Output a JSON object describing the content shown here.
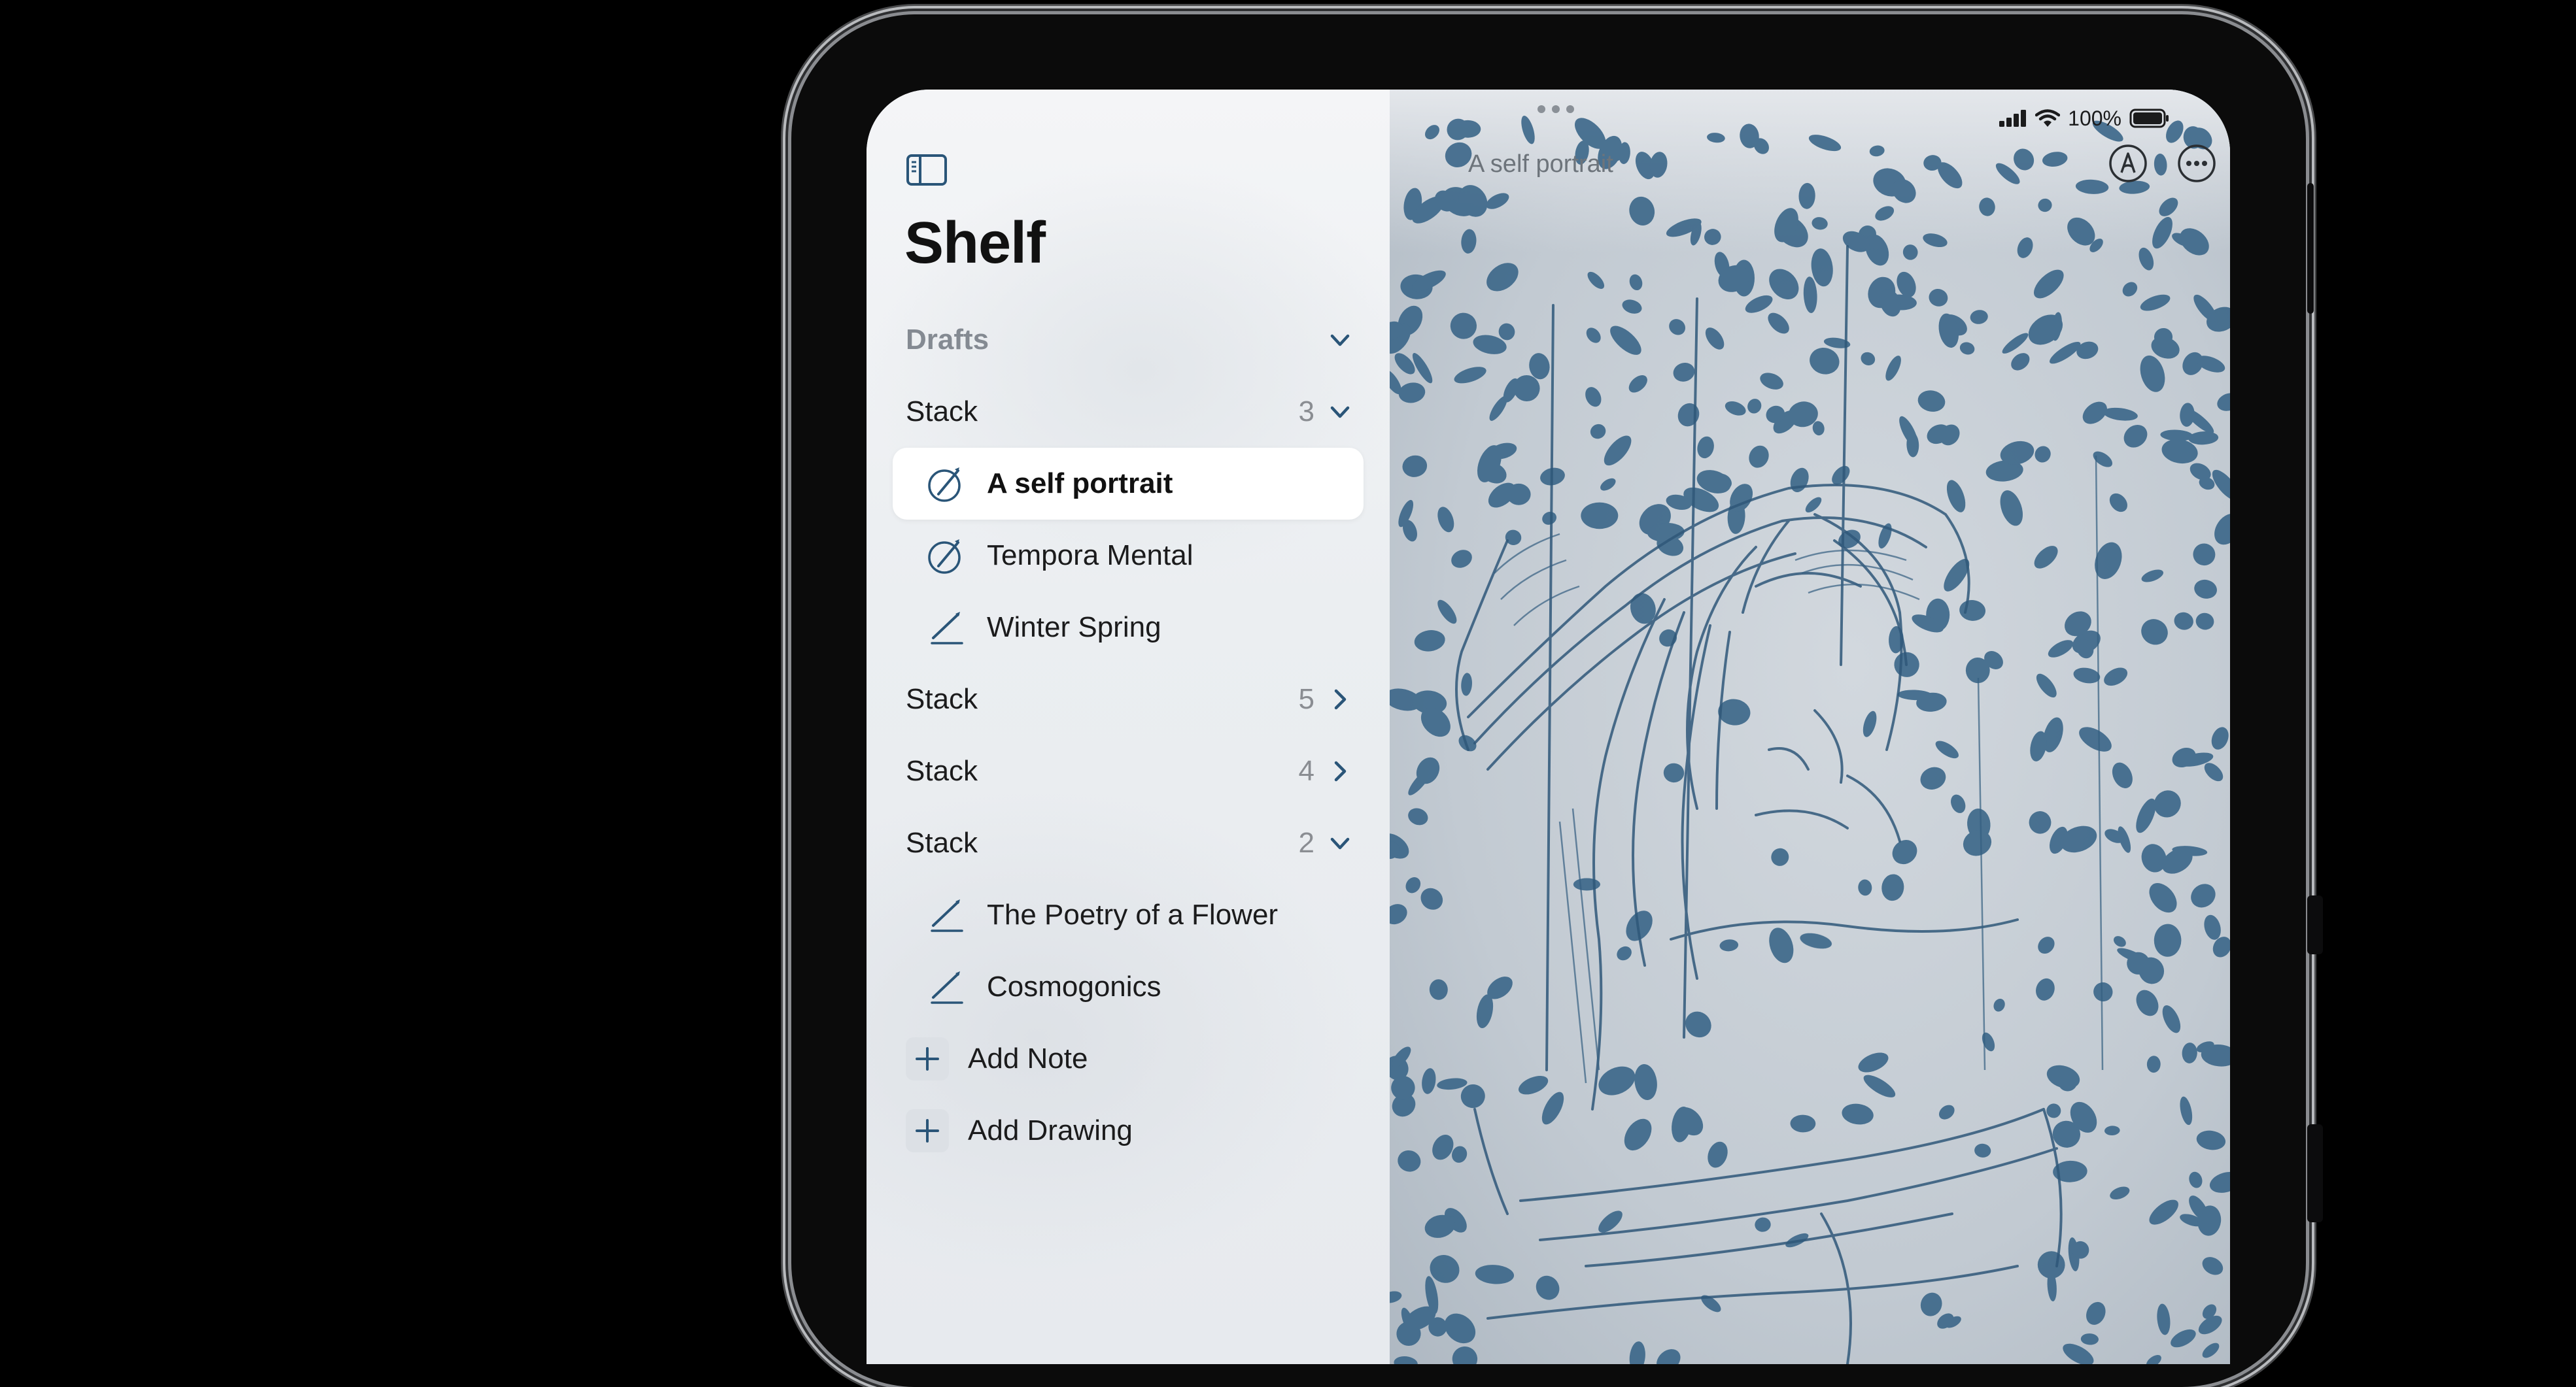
{
  "sidebar": {
    "title": "Shelf",
    "rows": [
      {
        "kind": "section",
        "label": "Drafts",
        "count": "",
        "chevron": "down"
      },
      {
        "kind": "section",
        "label": "Stack",
        "count": "3",
        "chevron": "down"
      },
      {
        "kind": "item",
        "label": "A self portrait",
        "icon": "pencil-circle-icon",
        "selected": true
      },
      {
        "kind": "item",
        "label": "Tempora Mental",
        "icon": "pencil-circle-icon"
      },
      {
        "kind": "item",
        "label": "Winter Spring",
        "icon": "pencil-icon"
      },
      {
        "kind": "section",
        "label": "Stack",
        "count": "5",
        "chevron": "right"
      },
      {
        "kind": "section",
        "label": "Stack",
        "count": "4",
        "chevron": "right"
      },
      {
        "kind": "section",
        "label": "Stack",
        "count": "2",
        "chevron": "down"
      },
      {
        "kind": "item",
        "label": "The Poetry of a Flower",
        "icon": "pencil-icon"
      },
      {
        "kind": "item",
        "label": "Cosmogonics",
        "icon": "pencil-icon"
      },
      {
        "kind": "add",
        "label": "Add Note",
        "icon": "plus-icon"
      },
      {
        "kind": "add",
        "label": "Add Drawing",
        "icon": "plus-icon"
      }
    ]
  },
  "document": {
    "title": "A self portrait"
  },
  "status_bar": {
    "battery": "100%"
  },
  "colors": {
    "accent": "#2a5578",
    "ink": "#2f5879",
    "paper": "#c8cfd6"
  }
}
